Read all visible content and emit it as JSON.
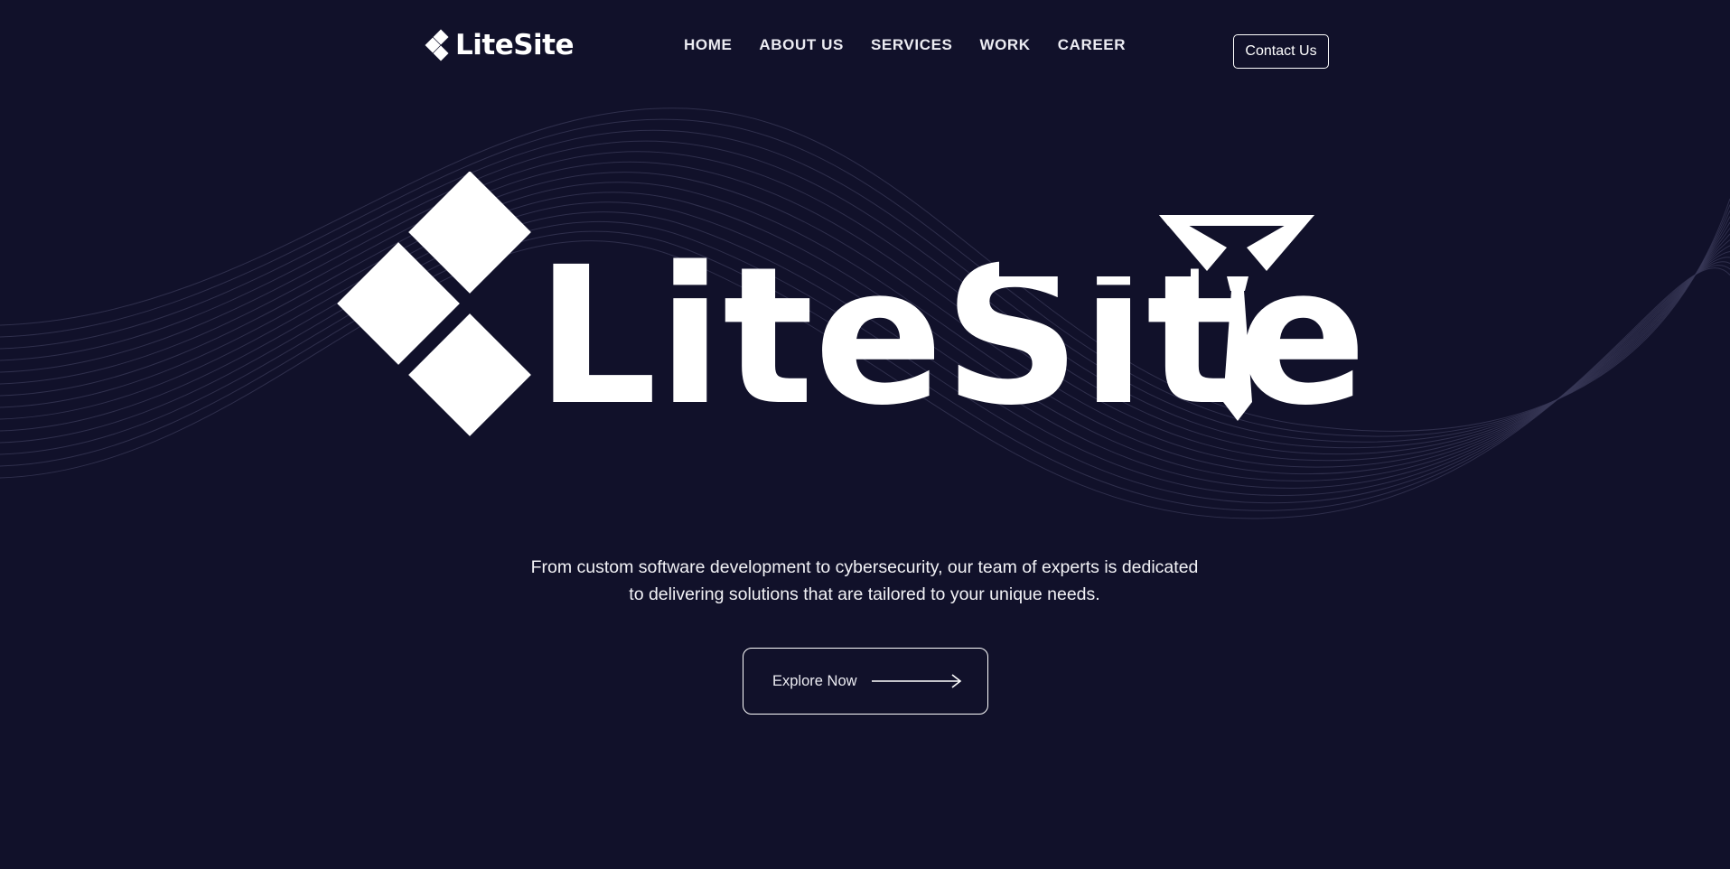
{
  "brand": {
    "name": "LiteSite",
    "logo_icon": "diamond-tie-logo-icon"
  },
  "nav": {
    "items": [
      {
        "label": "HOME"
      },
      {
        "label": "ABOUT US"
      },
      {
        "label": "SERVICES"
      },
      {
        "label": "WORK"
      },
      {
        "label": "CAREER"
      }
    ],
    "contact_label": "Contact Us"
  },
  "hero": {
    "logo_text": "LiteSite",
    "tagline_line1": "From custom software development to cybersecurity, our team of experts is dedicated",
    "tagline_line2": "to delivering solutions that are tailored to your unique needs.",
    "cta_label": "Explore Now",
    "cta_icon": "arrow-right-icon"
  },
  "colors": {
    "background": "#11112a",
    "foreground": "#ffffff",
    "wave_lines": "#3a3a58"
  }
}
